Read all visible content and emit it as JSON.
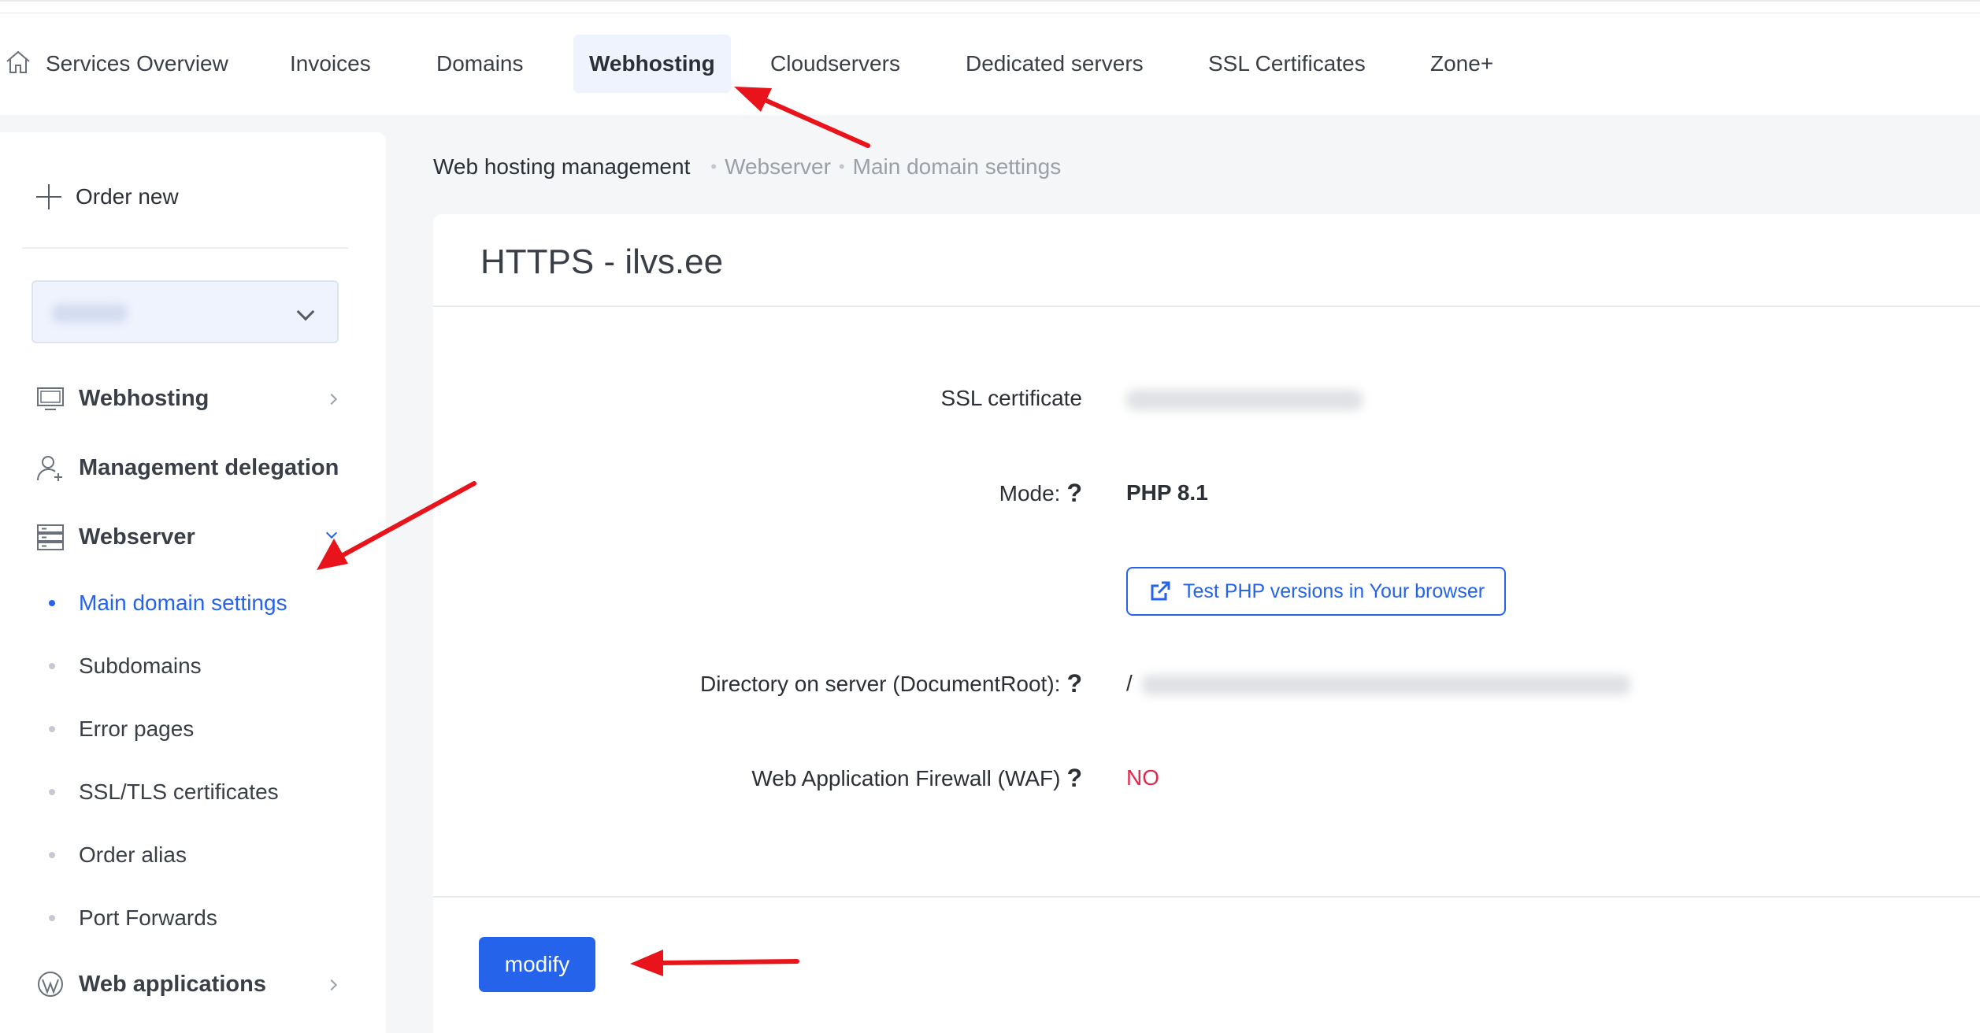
{
  "topnav": {
    "items": [
      {
        "label": "Services Overview"
      },
      {
        "label": "Invoices"
      },
      {
        "label": "Domains"
      },
      {
        "label": "Webhosting"
      },
      {
        "label": "Cloudservers"
      },
      {
        "label": "Dedicated servers"
      },
      {
        "label": "SSL Certificates"
      },
      {
        "label": "Zone+"
      }
    ],
    "active": "Webhosting",
    "icon": "home-icon"
  },
  "sidebar": {
    "order_new": "Order new",
    "selector_value": "",
    "menu": [
      {
        "label": "Webhosting",
        "icon": "monitor-icon"
      },
      {
        "label": "Management delegation",
        "icon": "user-plus-icon"
      },
      {
        "label": "Webserver",
        "icon": "server-icon"
      },
      {
        "label": "Web applications",
        "icon": "wordpress-icon"
      }
    ],
    "submenu": [
      {
        "label": "Main domain settings"
      },
      {
        "label": "Subdomains"
      },
      {
        "label": "Error pages"
      },
      {
        "label": "SSL/TLS certificates"
      },
      {
        "label": "Order alias"
      },
      {
        "label": "Port Forwards"
      }
    ],
    "active_submenu": "Main domain settings"
  },
  "breadcrumb": {
    "root": "Web hosting management",
    "level1": "Webserver",
    "level2": "Main domain settings",
    "separator": "•"
  },
  "card": {
    "title": "HTTPS - ilvs.ee",
    "fields": {
      "ssl_label": "SSL certificate",
      "ssl_value": "",
      "mode_label": "Mode:",
      "mode_value": "PHP 8.1",
      "test_button": "Test PHP versions in Your browser",
      "docroot_label": "Directory on server (DocumentRoot):",
      "docroot_value": "/",
      "waf_label": "Web Application Firewall (WAF)",
      "waf_value": "NO",
      "help_glyph": "?"
    },
    "modify_button": "modify"
  },
  "colors": {
    "accent": "#2563eb",
    "danger": "#e0294f",
    "annotation": "#e8131b",
    "active_tab_bg": "#eef3fd"
  }
}
